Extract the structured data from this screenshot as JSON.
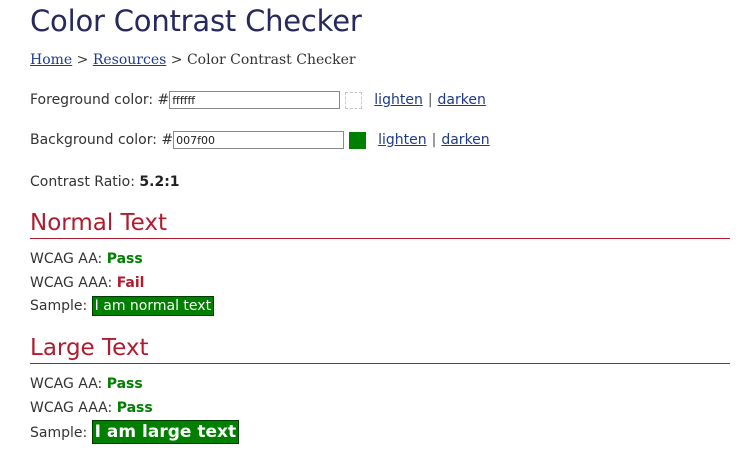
{
  "page": {
    "title": "Color Contrast Checker"
  },
  "breadcrumb": {
    "home": "Home",
    "sep1": " > ",
    "resources": "Resources",
    "sep2": " > ",
    "current": "Color Contrast Checker"
  },
  "foreground": {
    "label": "Foreground color: #",
    "value": "ffffff",
    "lighten": "lighten",
    "separator": "|",
    "darken": "darken",
    "swatch_color": "#ffffff"
  },
  "background": {
    "label": "Background color: #",
    "value": "007f00",
    "lighten": "lighten",
    "separator": "|",
    "darken": "darken",
    "swatch_color": "#007f00"
  },
  "contrast": {
    "label": "Contrast Ratio: ",
    "value": "5.2:1"
  },
  "normal_text": {
    "heading": "Normal Text",
    "aa_label": "WCAG AA: ",
    "aa_result": "Pass",
    "aaa_label": "WCAG AAA: ",
    "aaa_result": "Fail",
    "sample_label": "Sample: ",
    "sample_text": "I am normal text"
  },
  "large_text": {
    "heading": "Large Text",
    "aa_label": "WCAG AA: ",
    "aa_result": "Pass",
    "aaa_label": "WCAG AAA: ",
    "aaa_result": "Pass",
    "sample_label": "Sample: ",
    "sample_text": "I am large text"
  },
  "colors": {
    "title": "#28285e",
    "link": "#1e3a8a",
    "heading": "#b01c2e",
    "pass": "#007f00",
    "fail": "#b01c2e"
  }
}
